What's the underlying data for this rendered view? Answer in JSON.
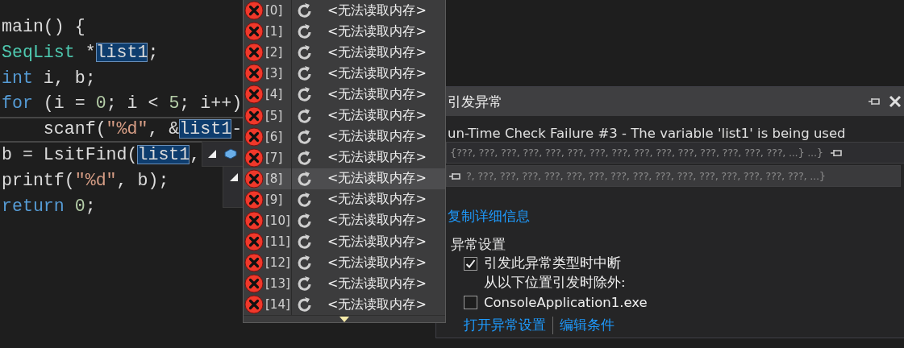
{
  "code_lines": [
    {
      "current": false,
      "tokens": [
        {
          "kind": "plain",
          "text": "main() {"
        }
      ]
    },
    {
      "current": false,
      "tokens": [
        {
          "kind": "type",
          "text": "SeqList"
        },
        {
          "kind": "plain",
          "text": " *"
        },
        {
          "kind": "highlight",
          "text": "list1"
        },
        {
          "kind": "plain",
          "text": ";"
        }
      ]
    },
    {
      "current": false,
      "tokens": [
        {
          "kind": "keyword",
          "text": "int"
        },
        {
          "kind": "plain",
          "text": " i, b;"
        }
      ]
    },
    {
      "current": false,
      "tokens": [
        {
          "kind": "keyword",
          "text": "for"
        },
        {
          "kind": "plain",
          "text": " (i = "
        },
        {
          "kind": "number",
          "text": "0"
        },
        {
          "kind": "plain",
          "text": "; i < "
        },
        {
          "kind": "number",
          "text": "5"
        },
        {
          "kind": "plain",
          "text": "; i++)"
        }
      ]
    },
    {
      "current": true,
      "tokens": [
        {
          "kind": "plain",
          "text": "    scanf("
        },
        {
          "kind": "string",
          "text": "\"%d\""
        },
        {
          "kind": "plain",
          "text": ", &"
        },
        {
          "kind": "highlight",
          "text": "list1"
        },
        {
          "kind": "plain",
          "text": "-"
        }
      ]
    },
    {
      "current": false,
      "tokens": [
        {
          "kind": "plain",
          "text": "b = LsitFind("
        },
        {
          "kind": "highlight",
          "text": "list1"
        },
        {
          "kind": "plain",
          "text": ","
        }
      ]
    },
    {
      "current": false,
      "tokens": [
        {
          "kind": "plain",
          "text": "printf("
        },
        {
          "kind": "string",
          "text": "\"%d\""
        },
        {
          "kind": "plain",
          "text": ", b);"
        }
      ]
    },
    {
      "current": false,
      "tokens": [
        {
          "kind": "keyword",
          "text": "return"
        },
        {
          "kind": "number",
          "text": " 0"
        },
        {
          "kind": "plain",
          "text": ";"
        }
      ]
    }
  ],
  "datatip": [
    {
      "expanded": true,
      "value": "{???, ???, ???, ???, ???, ???, ???, ???, ???, ???, ???, ???, ???, ???, ???, ...} ...}"
    },
    {
      "expanded": true,
      "value": "?, ???, ???, ???, ???, ???, ???, ???, ???, ???, ???, ???, ???, ???, ???, ???, ...}"
    }
  ],
  "memory_list": [
    {
      "index": "[0]",
      "value": "<无法读取内存>",
      "selected": false
    },
    {
      "index": "[1]",
      "value": "<无法读取内存>",
      "selected": false
    },
    {
      "index": "[2]",
      "value": "<无法读取内存>",
      "selected": false
    },
    {
      "index": "[3]",
      "value": "<无法读取内存>",
      "selected": false
    },
    {
      "index": "[4]",
      "value": "<无法读取内存>",
      "selected": false
    },
    {
      "index": "[5]",
      "value": "<无法读取内存>",
      "selected": false
    },
    {
      "index": "[6]",
      "value": "<无法读取内存>",
      "selected": false
    },
    {
      "index": "[7]",
      "value": "<无法读取内存>",
      "selected": false
    },
    {
      "index": "[8]",
      "value": "<无法读取内存>",
      "selected": true
    },
    {
      "index": "[9]",
      "value": "<无法读取内存>",
      "selected": false
    },
    {
      "index": "[10]",
      "value": "<无法读取内存>",
      "selected": false
    },
    {
      "index": "[11]",
      "value": "<无法读取内存>",
      "selected": false
    },
    {
      "index": "[12]",
      "value": "<无法读取内存>",
      "selected": false
    },
    {
      "index": "[13]",
      "value": "<无法读取内存>",
      "selected": false
    },
    {
      "index": "[14]",
      "value": "<无法读取内存>",
      "selected": false
    }
  ],
  "exception_panel": {
    "title": "引发异常",
    "message": "un-Time Check Failure #3 - The variable 'list1' is being used",
    "copy_link": "复制详细信息",
    "settings_title": "异常设置",
    "options": [
      {
        "kind": "checkbox",
        "label": "引发此异常类型时中断",
        "checked": true
      },
      {
        "kind": "note",
        "label": "从以下位置引发时除外:"
      },
      {
        "kind": "checkbox",
        "label": "ConsoleApplication1.exe",
        "checked": false
      }
    ],
    "links": [
      "打开异常设置",
      "编辑条件"
    ]
  }
}
